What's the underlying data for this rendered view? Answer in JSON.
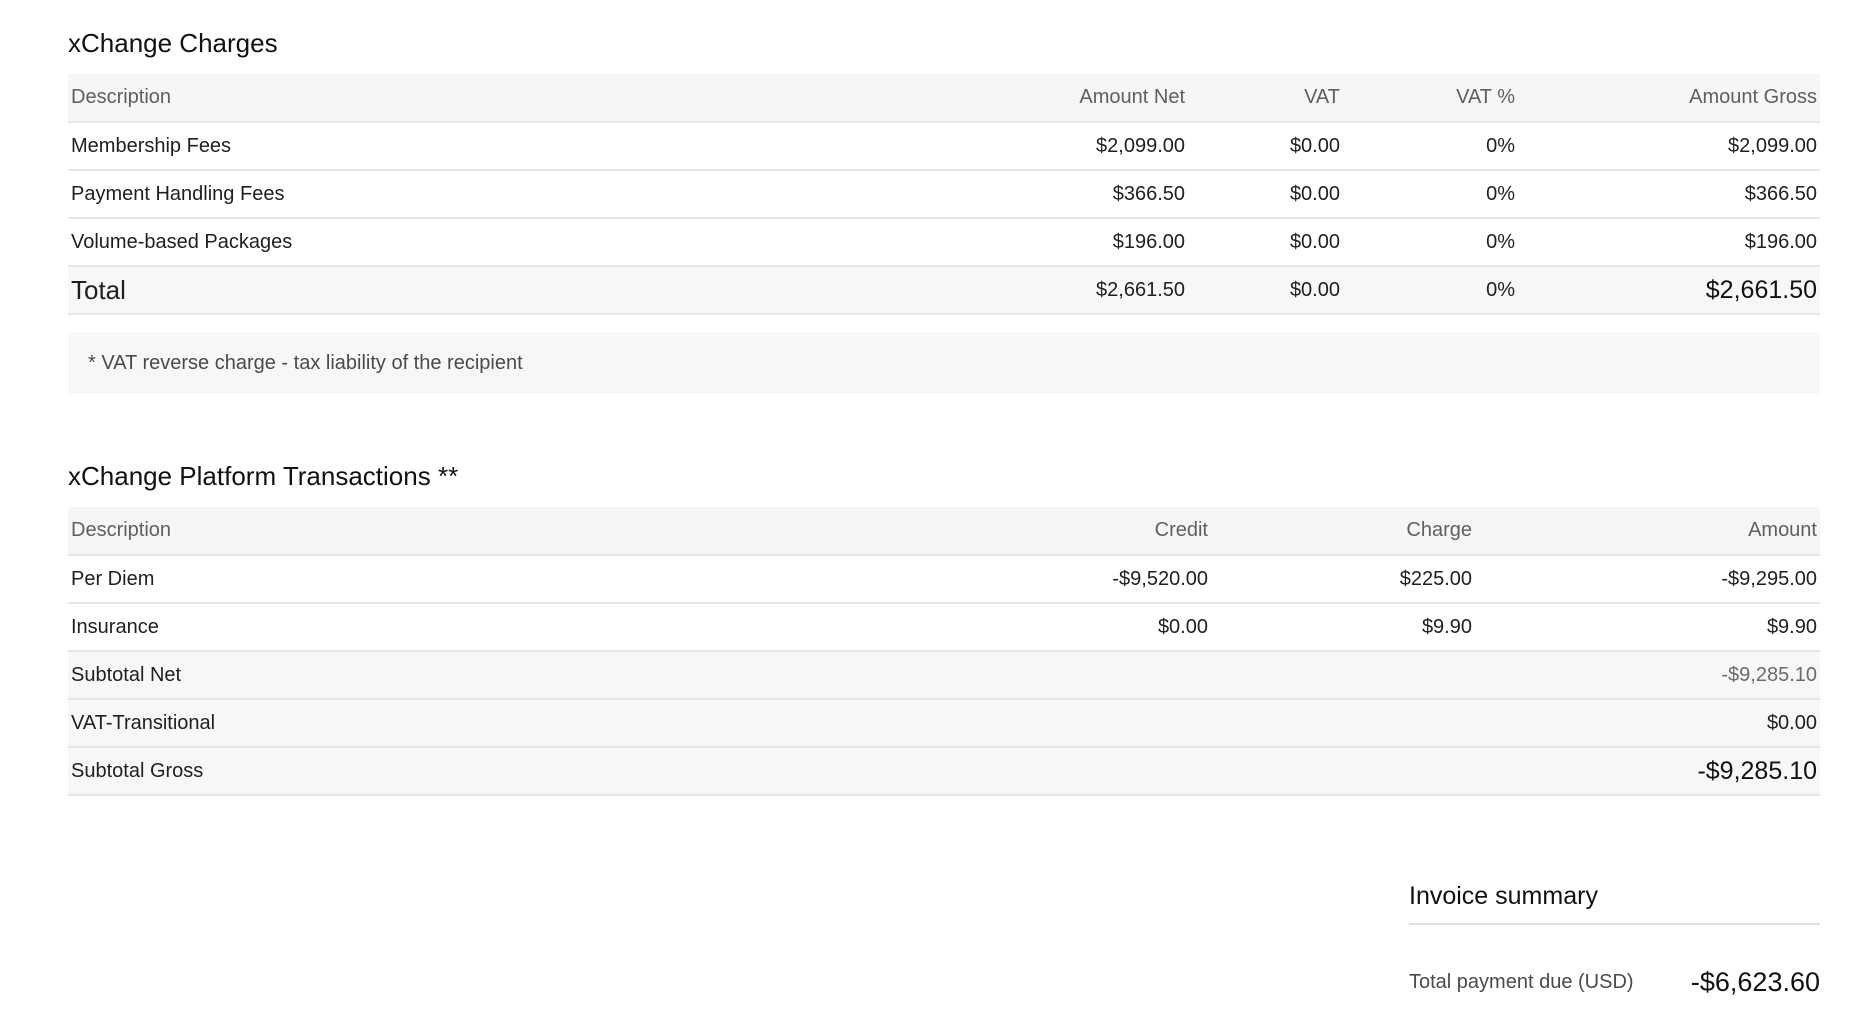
{
  "charges": {
    "title": "xChange Charges",
    "headers": {
      "description": "Description",
      "amount_net": "Amount Net",
      "vat": "VAT",
      "vat_pct": "VAT %",
      "amount_gross": "Amount Gross"
    },
    "rows": [
      {
        "description": "Membership Fees",
        "amount_net": "$2,099.00",
        "vat": "$0.00",
        "vat_pct": "0%",
        "amount_gross": "$2,099.00"
      },
      {
        "description": "Payment Handling Fees",
        "amount_net": "$366.50",
        "vat": "$0.00",
        "vat_pct": "0%",
        "amount_gross": "$366.50"
      },
      {
        "description": "Volume-based Packages",
        "amount_net": "$196.00",
        "vat": "$0.00",
        "vat_pct": "0%",
        "amount_gross": "$196.00"
      }
    ],
    "total": {
      "label": "Total",
      "amount_net": "$2,661.50",
      "vat": "$0.00",
      "vat_pct": "0%",
      "amount_gross": "$2,661.50"
    },
    "note": "* VAT reverse charge - tax liability of the recipient"
  },
  "transactions": {
    "title": "xChange Platform Transactions **",
    "headers": {
      "description": "Description",
      "credit": "Credit",
      "charge": "Charge",
      "amount": "Amount"
    },
    "rows": [
      {
        "description": "Per Diem",
        "credit": "-$9,520.00",
        "charge": "$225.00",
        "amount": "-$9,295.00"
      },
      {
        "description": "Insurance",
        "credit": "$0.00",
        "charge": "$9.90",
        "amount": "$9.90"
      }
    ],
    "subtotal_net": {
      "label": "Subtotal Net",
      "amount": "-$9,285.10"
    },
    "vat_transitional": {
      "label": "VAT-Transitional",
      "amount": "$0.00"
    },
    "subtotal_gross": {
      "label": "Subtotal Gross",
      "amount": "-$9,285.10"
    }
  },
  "summary": {
    "title": "Invoice summary",
    "total_label": "Total payment due (USD)",
    "total_value": "-$6,623.60"
  }
}
